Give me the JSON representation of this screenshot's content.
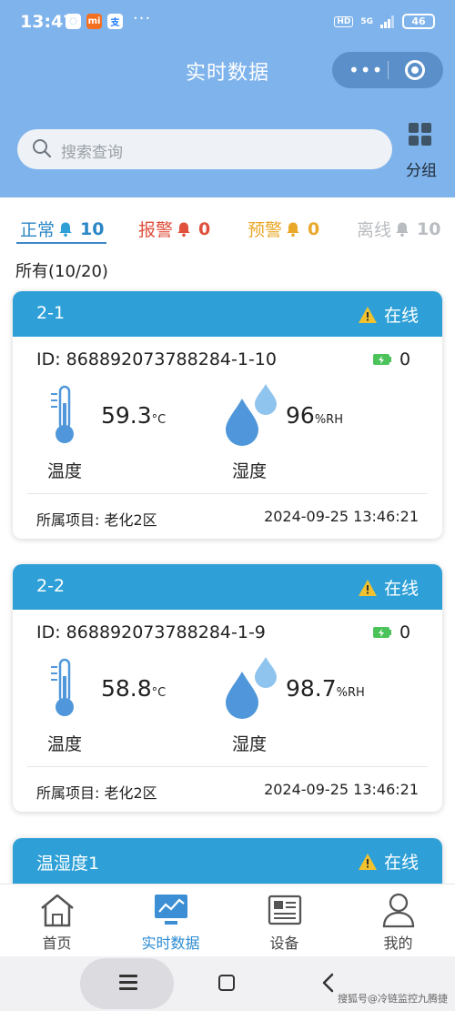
{
  "status_bar": {
    "time": "13:47",
    "more": "···",
    "hd": "HD",
    "network": "5G",
    "battery": "46"
  },
  "header": {
    "title": "实时数据",
    "capsule_more": "•••"
  },
  "search": {
    "placeholder": "搜索查询"
  },
  "group_button": {
    "label": "分组"
  },
  "tabs": [
    {
      "label": "正常",
      "count": "10",
      "color": "#2b86c5"
    },
    {
      "label": "报警",
      "count": "0",
      "color": "#e0503c"
    },
    {
      "label": "预警",
      "count": "0",
      "color": "#e9a82a"
    },
    {
      "label": "离线",
      "count": "10",
      "color": "#b9bcc0"
    }
  ],
  "all_label": "所有(10/20)",
  "cards": [
    {
      "name": "2-1",
      "status": "在线",
      "id": "ID: 868892073788284-1-10",
      "battery_count": "0",
      "temp_value": "59.3",
      "temp_unit": "°C",
      "hum_value": "96",
      "hum_unit": "%RH",
      "temp_label": "温度",
      "hum_label": "湿度",
      "project": "所属项目: 老化2区",
      "time": "2024-09-25 13:46:21"
    },
    {
      "name": "2-2",
      "status": "在线",
      "id": "ID: 868892073788284-1-9",
      "battery_count": "0",
      "temp_value": "58.8",
      "temp_unit": "°C",
      "hum_value": "98.7",
      "hum_unit": "%RH",
      "temp_label": "温度",
      "hum_label": "湿度",
      "project": "所属项目: 老化2区",
      "time": "2024-09-25 13:46:21"
    },
    {
      "name": "温湿度1",
      "status": "在线"
    }
  ],
  "tabbar": [
    {
      "label": "首页"
    },
    {
      "label": "实时数据"
    },
    {
      "label": "设备"
    },
    {
      "label": "我的"
    }
  ],
  "watermark": "搜狐号@冷链监控九腾捷",
  "colors": {
    "header_bg": "#7fb3ec",
    "card_header": "#2ea0d7",
    "active_tab": "#2b8bd1",
    "warning": "#f2c12e"
  }
}
